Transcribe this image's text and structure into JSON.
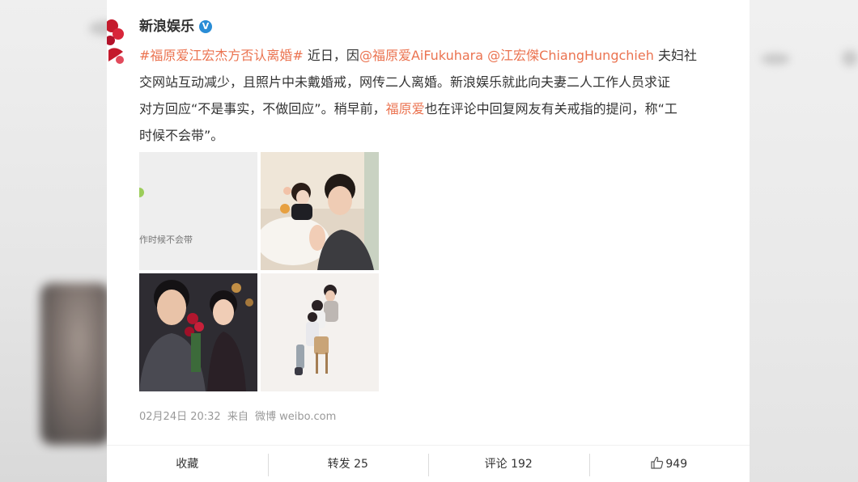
{
  "post": {
    "author": "新浪娱乐",
    "verified_icon": "verified-v-icon",
    "hashtag": "#福原爱江宏杰方否认离婚#",
    "line1_a": "近日，因",
    "mention1": "@福原爱AiFukuhara",
    "mention2": "@江宏傑ChiangHungchieh",
    "line1_b": "夫妇社",
    "line2": "交网站互动减少，且照片中未戴婚戒，网传二人离婚。新浪娱乐就此向夫妻二人工作人员求证",
    "line3_a": "对方回应“不是事实，不做回应”。稍早前，",
    "line3_name": "福原爱",
    "line3_b": "也在评论中回复网友有关戒指的提问，称“工",
    "line4": "时候不会带”。",
    "image1_caption": "作时候不会带",
    "timestamp": "02月24日 20:32",
    "source_prefix": "来自",
    "source": "微博 weibo.com"
  },
  "actions": {
    "favorite": "收藏",
    "repost_label": "转发",
    "repost_count": "25",
    "comment_label": "评论",
    "comment_count": "192",
    "like_icon": "thumbs-up-icon",
    "like_count": "949"
  },
  "colors": {
    "link": "#eb7350",
    "verified": "#2a8dd6"
  }
}
